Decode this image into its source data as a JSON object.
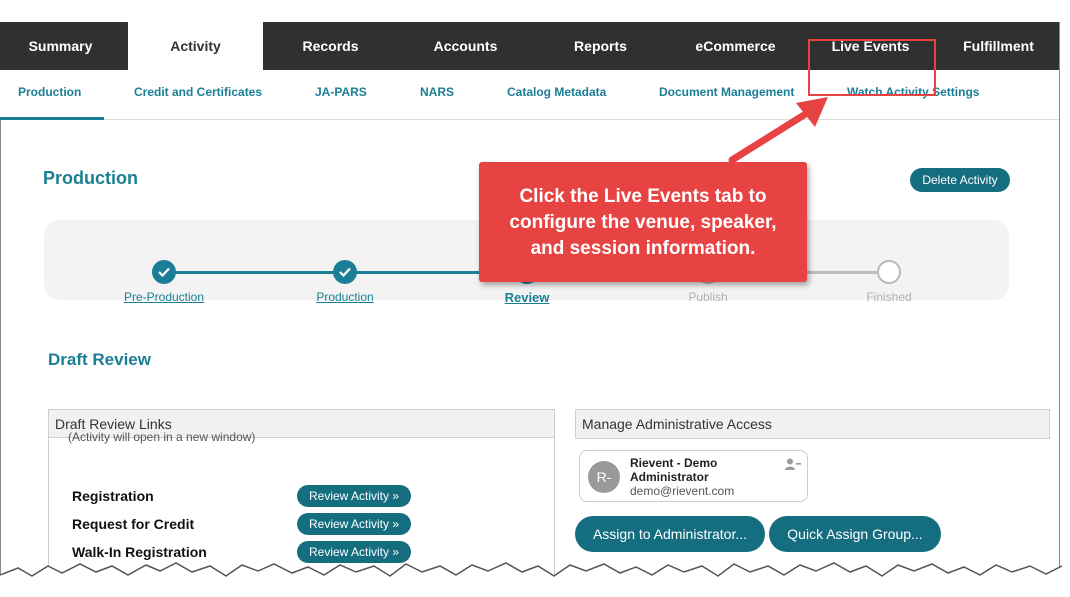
{
  "top_tabs": [
    {
      "label": "Summary",
      "active": false
    },
    {
      "label": "Activity",
      "active": true
    },
    {
      "label": "Records",
      "active": false
    },
    {
      "label": "Accounts",
      "active": false
    },
    {
      "label": "Reports",
      "active": false
    },
    {
      "label": "eCommerce",
      "active": false
    },
    {
      "label": "Live Events",
      "active": false
    },
    {
      "label": "Fulfillment",
      "active": false
    }
  ],
  "sub_tabs": [
    {
      "label": "Production",
      "active": true
    },
    {
      "label": "Credit and Certificates",
      "active": false
    },
    {
      "label": "JA-PARS",
      "active": false
    },
    {
      "label": "NARS",
      "active": false
    },
    {
      "label": "Catalog Metadata",
      "active": false
    },
    {
      "label": "Document Management",
      "active": false
    },
    {
      "label": "Watch Activity Settings",
      "active": false
    }
  ],
  "page": {
    "title": "Production",
    "delete_label": "Delete Activity"
  },
  "stepper": {
    "steps": [
      {
        "label": "Pre-Production",
        "state": "done"
      },
      {
        "label": "Production",
        "state": "done"
      },
      {
        "label": "Review",
        "state": "current"
      },
      {
        "label": "Publish",
        "state": "future"
      },
      {
        "label": "Finished",
        "state": "future"
      }
    ]
  },
  "draft": {
    "title": "Draft Review",
    "links_panel_title": "Draft Review Links",
    "note": "(Activity will open in a new window)",
    "rows": [
      {
        "label": "Registration",
        "button": "Review Activity »"
      },
      {
        "label": "Request for Credit",
        "button": "Review Activity »"
      },
      {
        "label": "Walk-In Registration",
        "button": "Review Activity »"
      }
    ]
  },
  "admin": {
    "panel_title": "Manage Administrative Access",
    "avatar_initials": "R-",
    "name": "Rievent - Demo Administrator",
    "email": "demo@rievent.com",
    "assign_label": "Assign to Administrator...",
    "quick_label": "Quick Assign Group..."
  },
  "callout": {
    "line1": "Click the Live Events tab to",
    "line2": "configure the venue, speaker,",
    "line3": "and session information."
  },
  "colors": {
    "nav_bg": "#303030",
    "accent": "#1a7f96",
    "button": "#156e80",
    "callout": "#e84343"
  }
}
